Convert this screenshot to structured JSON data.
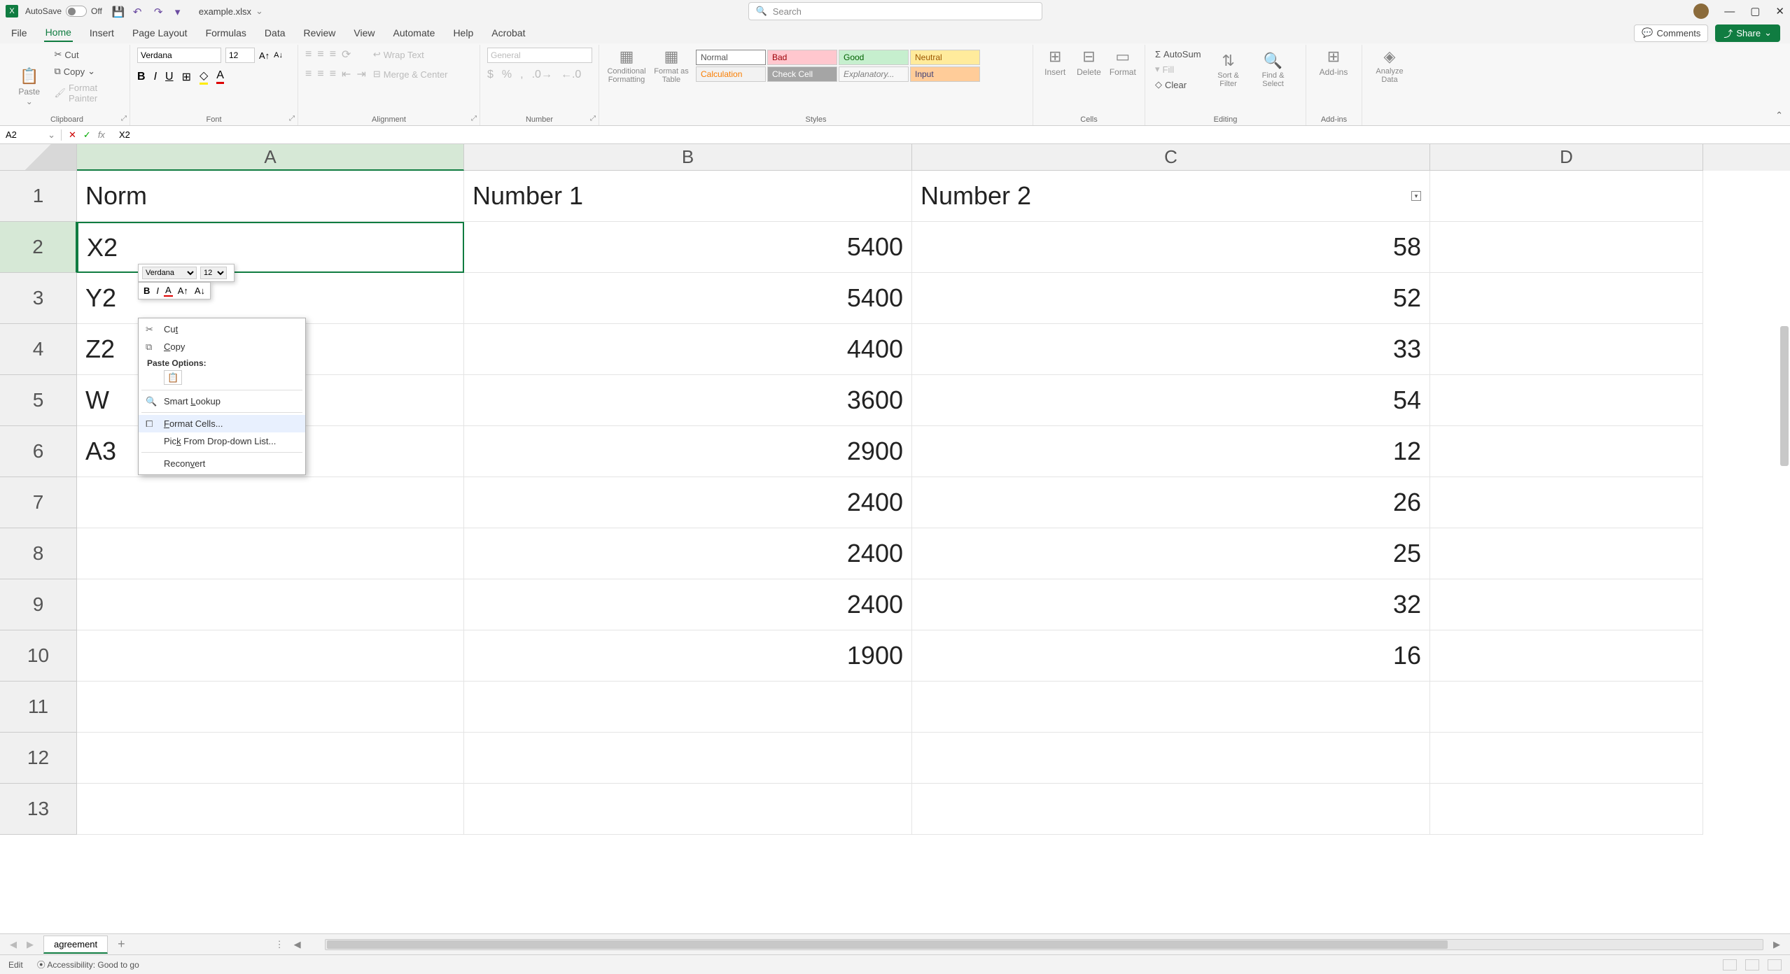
{
  "titlebar": {
    "autosave_label": "AutoSave",
    "autosave_state": "Off",
    "file_name": "example.xlsx",
    "search_placeholder": "Search"
  },
  "menu": {
    "tabs": [
      "File",
      "Home",
      "Insert",
      "Page Layout",
      "Formulas",
      "Data",
      "Review",
      "View",
      "Automate",
      "Help",
      "Acrobat"
    ],
    "active": "Home",
    "comments": "Comments",
    "share": "Share"
  },
  "ribbon": {
    "clipboard": {
      "paste": "Paste",
      "cut": "Cut",
      "copy": "Copy",
      "format_painter": "Format Painter",
      "label": "Clipboard"
    },
    "font": {
      "name": "Verdana",
      "size": "12",
      "label": "Font"
    },
    "alignment": {
      "wrap": "Wrap Text",
      "merge": "Merge & Center",
      "label": "Alignment"
    },
    "number": {
      "format": "General",
      "label": "Number"
    },
    "styles": {
      "cond": "Conditional Formatting",
      "fat": "Format as Table",
      "format": "Format",
      "gallery": [
        "Normal",
        "Bad",
        "Good",
        "Neutral",
        "Calculation",
        "Check Cell",
        "Explanatory...",
        "Input"
      ],
      "label": "Styles"
    },
    "cells": {
      "insert": "Insert",
      "delete": "Delete",
      "format": "Format",
      "label": "Cells"
    },
    "editing": {
      "autosum": "AutoSum",
      "fill": "Fill",
      "clear": "Clear",
      "sort": "Sort & Filter",
      "find": "Find & Select",
      "label": "Editing"
    },
    "addins": {
      "addins": "Add-ins",
      "label": "Add-ins"
    },
    "analyze": {
      "label_btn": "Analyze Data"
    }
  },
  "formula_bar": {
    "name_box": "A2",
    "formula": "X2"
  },
  "grid": {
    "columns": [
      "A",
      "B",
      "C",
      "D"
    ],
    "headers": {
      "A": "Norm",
      "B": "Number 1",
      "C": "Number 2",
      "D": ""
    },
    "rows": [
      {
        "n": "1",
        "A": "Norm",
        "B": "Number 1",
        "C": "Number 2",
        "D": ""
      },
      {
        "n": "2",
        "A": "X2",
        "B": "5400",
        "C": "58",
        "D": ""
      },
      {
        "n": "3",
        "A": "Y2",
        "B": "5400",
        "C": "52",
        "D": ""
      },
      {
        "n": "4",
        "A": "Z2",
        "B": "4400",
        "C": "33",
        "D": ""
      },
      {
        "n": "5",
        "A": "W",
        "B": "3600",
        "C": "54",
        "D": ""
      },
      {
        "n": "6",
        "A": "A3",
        "B": "2900",
        "C": "12",
        "D": ""
      },
      {
        "n": "7",
        "A": "",
        "B": "2400",
        "C": "26",
        "D": ""
      },
      {
        "n": "8",
        "A": "",
        "B": "2400",
        "C": "25",
        "D": ""
      },
      {
        "n": "9",
        "A": "",
        "B": "2400",
        "C": "32",
        "D": ""
      },
      {
        "n": "10",
        "A": "",
        "B": "1900",
        "C": "16",
        "D": ""
      },
      {
        "n": "11",
        "A": "",
        "B": "",
        "C": "",
        "D": ""
      },
      {
        "n": "12",
        "A": "",
        "B": "",
        "C": "",
        "D": ""
      },
      {
        "n": "13",
        "A": "",
        "B": "",
        "C": "",
        "D": ""
      }
    ],
    "selected": "A2"
  },
  "mini_toolbar": {
    "font": "Verdana",
    "size": "12"
  },
  "context_menu": {
    "cut": "Cut",
    "copy": "Copy",
    "paste_heading": "Paste Options:",
    "smart_lookup": "Smart Lookup",
    "format_cells": "Format Cells...",
    "pick_list": "Pick From Drop-down List...",
    "reconvert": "Reconvert"
  },
  "sheet_tabs": {
    "active": "agreement"
  },
  "status_bar": {
    "mode": "Edit",
    "accessibility": "Accessibility: Good to go"
  }
}
